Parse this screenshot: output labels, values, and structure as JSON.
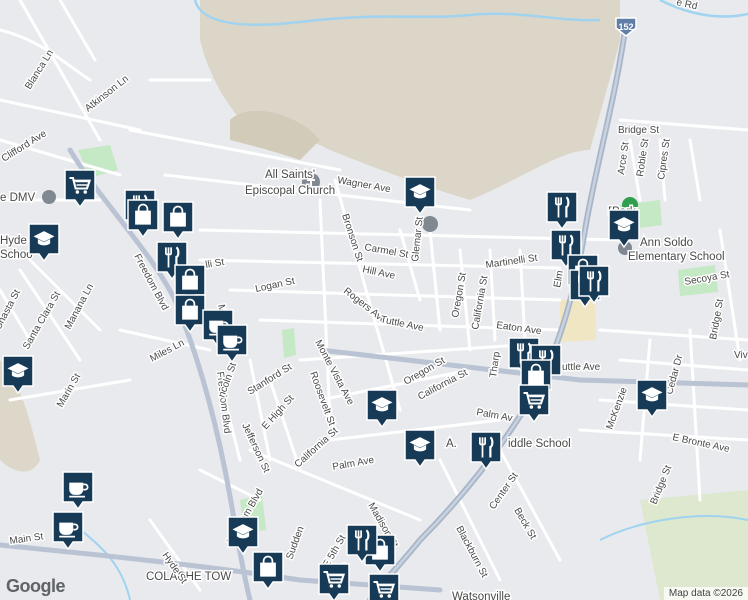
{
  "map": {
    "attribution": "Map data ©2026",
    "logo_text": "Google",
    "highway_shield": "152",
    "colors": {
      "background": "#e8eaed",
      "hills": "#dcd6c8",
      "park": "#c5e8c5",
      "water": "#9fd3f0",
      "highway": "#a8b5c8",
      "marker": "#173b57",
      "marker_border": "#ffffff"
    },
    "poi_labels": [
      {
        "id": "all-saints-1",
        "text": "All Saints'"
      },
      {
        "id": "all-saints-2",
        "text": "Episcopal Church"
      },
      {
        "id": "dmv",
        "text": "e DMV"
      },
      {
        "id": "hyde-1",
        "text": "Hyde"
      },
      {
        "id": "hyde-2",
        "text": "Schoo"
      },
      {
        "id": "ann-soldo-1",
        "text": "Ann Soldo"
      },
      {
        "id": "ann-soldo-2",
        "text": "Elementary School"
      },
      {
        "id": "fpark",
        "text": "F"
      },
      {
        "id": "fpark2",
        "text": "Park"
      },
      {
        "id": "middle-school-a",
        "text": "A."
      },
      {
        "id": "middle-school-b",
        "text": "iddle School"
      },
      {
        "id": "colache",
        "text": "COLACHE TOW"
      },
      {
        "id": "watsonville",
        "text": "Watsonville"
      }
    ],
    "street_labels": [
      {
        "id": "blanca",
        "text": "Blanca Ln"
      },
      {
        "id": "atkinson",
        "text": "Atkinson Ln"
      },
      {
        "id": "clifford",
        "text": "Clifford Ave"
      },
      {
        "id": "freedom1",
        "text": "Freedom Blvd"
      },
      {
        "id": "freedom2",
        "text": "Freedom Blvd"
      },
      {
        "id": "freedom3",
        "text": "Freedom Blvd"
      },
      {
        "id": "wagner",
        "text": "Wagner Ave"
      },
      {
        "id": "carmel",
        "text": "Carmel St"
      },
      {
        "id": "hill",
        "text": "Hill Ave"
      },
      {
        "id": "bronson",
        "text": "Bronson St"
      },
      {
        "id": "glemar",
        "text": "Glemar St"
      },
      {
        "id": "oregon1",
        "text": "Oregon St"
      },
      {
        "id": "oregon2",
        "text": "Oregon St"
      },
      {
        "id": "california1",
        "text": "California St"
      },
      {
        "id": "california2",
        "text": "California St"
      },
      {
        "id": "california3",
        "text": "California St"
      },
      {
        "id": "martinelli1",
        "text": "Martinelli St"
      },
      {
        "id": "martinelli2",
        "text": "lli St"
      },
      {
        "id": "logan",
        "text": "Logan St"
      },
      {
        "id": "rogers",
        "text": "Rogers Ave"
      },
      {
        "id": "tuttle1",
        "text": "Tuttle Ave"
      },
      {
        "id": "tuttle2",
        "text": "uttle Ave"
      },
      {
        "id": "eaton",
        "text": "Eaton Ave"
      },
      {
        "id": "monte-vista",
        "text": "Monte Vista Ave"
      },
      {
        "id": "roosevelt",
        "text": "Roosevelt St"
      },
      {
        "id": "stanford",
        "text": "Stanford St"
      },
      {
        "id": "lincoln",
        "text": "ncoln St"
      },
      {
        "id": "e-high",
        "text": "E High St"
      },
      {
        "id": "jefferson",
        "text": "Jefferson St"
      },
      {
        "id": "palm1",
        "text": "Palm Ave"
      },
      {
        "id": "palm2",
        "text": "Palm Av"
      },
      {
        "id": "madison",
        "text": "Madison St"
      },
      {
        "id": "blackburn",
        "text": "Blackburn St"
      },
      {
        "id": "center",
        "text": "Center St"
      },
      {
        "id": "beck",
        "text": "Beck St"
      },
      {
        "id": "bridge1",
        "text": "Bridge St"
      },
      {
        "id": "bridge2",
        "text": "Bridge St"
      },
      {
        "id": "bridge3",
        "text": "Bridge St"
      },
      {
        "id": "arce",
        "text": "Arce St"
      },
      {
        "id": "roble",
        "text": "Roble St"
      },
      {
        "id": "cipres",
        "text": "Cipres St"
      },
      {
        "id": "secoya",
        "text": "Secoya St"
      },
      {
        "id": "mckenzie",
        "text": "McKenzie"
      },
      {
        "id": "cedar",
        "text": "Cedar Dr"
      },
      {
        "id": "e-bronte",
        "text": "E Bronte Ave"
      },
      {
        "id": "viv",
        "text": "Viv"
      },
      {
        "id": "tharp",
        "text": "Tharp"
      },
      {
        "id": "miles",
        "text": "Miles Ln"
      },
      {
        "id": "marin",
        "text": "Marin St"
      },
      {
        "id": "manana",
        "text": "Manana Ln"
      },
      {
        "id": "santa-clara",
        "text": "Santa Clara St"
      },
      {
        "id": "shasta",
        "text": "Shasta St"
      },
      {
        "id": "main",
        "text": "Main St"
      },
      {
        "id": "hyde-st",
        "text": "Hyde St"
      },
      {
        "id": "e5th",
        "text": "E 5th St"
      },
      {
        "id": "sudden",
        "text": "Sudden"
      },
      {
        "id": "ridge-rd",
        "text": "e Rd"
      },
      {
        "id": "rogers-ave-2",
        "text": "Ma"
      },
      {
        "id": "elm",
        "text": "Elm"
      },
      {
        "id": "mad2",
        "text": "Ma"
      }
    ],
    "markers": [
      {
        "id": "m1",
        "icon": "shopping-cart"
      },
      {
        "id": "m2",
        "icon": "school"
      },
      {
        "id": "m3",
        "icon": "restaurant"
      },
      {
        "id": "m4",
        "icon": "shopping-bag"
      },
      {
        "id": "m5",
        "icon": "shopping-bag"
      },
      {
        "id": "m6",
        "icon": "restaurant"
      },
      {
        "id": "m7",
        "icon": "shopping-bag"
      },
      {
        "id": "m8",
        "icon": "shopping-bag"
      },
      {
        "id": "m9",
        "icon": "cafe"
      },
      {
        "id": "m10",
        "icon": "cafe"
      },
      {
        "id": "m11",
        "icon": "school"
      },
      {
        "id": "m12",
        "icon": "school"
      },
      {
        "id": "m13",
        "icon": "school"
      },
      {
        "id": "m14",
        "icon": "restaurant"
      },
      {
        "id": "m15",
        "icon": "restaurant"
      },
      {
        "id": "m16",
        "icon": "shopping-bag"
      },
      {
        "id": "m17",
        "icon": "school"
      },
      {
        "id": "m18",
        "icon": "restaurant"
      },
      {
        "id": "m19",
        "icon": "restaurant"
      },
      {
        "id": "m20",
        "icon": "restaurant"
      },
      {
        "id": "m21",
        "icon": "shopping-bag"
      },
      {
        "id": "m22",
        "icon": "shopping-cart"
      },
      {
        "id": "m23",
        "icon": "school"
      },
      {
        "id": "m24",
        "icon": "restaurant"
      },
      {
        "id": "m25",
        "icon": "school"
      },
      {
        "id": "m26",
        "icon": "cafe"
      },
      {
        "id": "m27",
        "icon": "cafe"
      },
      {
        "id": "m28",
        "icon": "school"
      },
      {
        "id": "m29",
        "icon": "shopping-bag"
      },
      {
        "id": "m30",
        "icon": "shopping-bag"
      },
      {
        "id": "m31",
        "icon": "shopping-cart"
      },
      {
        "id": "m32",
        "icon": "restaurant"
      },
      {
        "id": "m33",
        "icon": "shopping-cart"
      },
      {
        "id": "m34",
        "icon": "restaurant"
      }
    ]
  }
}
